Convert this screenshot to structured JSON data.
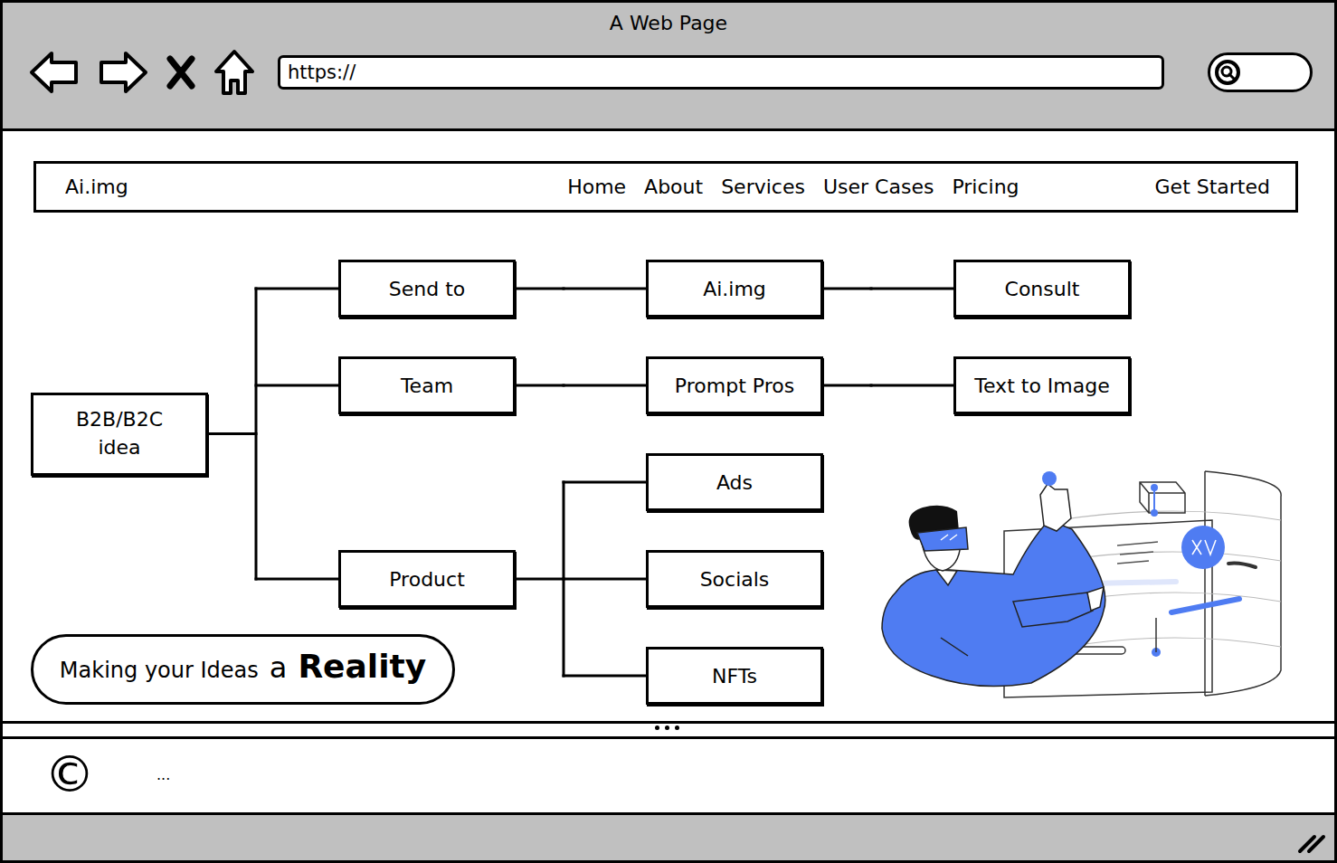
{
  "window": {
    "title": "A Web Page"
  },
  "address_bar": {
    "value": "https://"
  },
  "navbar": {
    "brand": "Ai.img",
    "links": [
      "Home",
      "About",
      "Services",
      "User Cases",
      "Pricing"
    ],
    "cta": "Get Started"
  },
  "diagram": {
    "root": {
      "label": "B2B/B2C idea",
      "children": [
        {
          "label": "Send to",
          "children": [
            {
              "label": "Ai.img",
              "children": [
                {
                  "label": "Consult",
                  "children": []
                }
              ]
            }
          ]
        },
        {
          "label": "Team",
          "children": [
            {
              "label": "Prompt Pros",
              "children": [
                {
                  "label": "Text to Image",
                  "children": []
                }
              ]
            }
          ]
        },
        {
          "label": "Product",
          "children": [
            {
              "label": "Ads",
              "children": []
            },
            {
              "label": "Socials",
              "children": []
            },
            {
              "label": "NFTs",
              "children": []
            }
          ]
        }
      ]
    }
  },
  "tagline": {
    "parts": [
      {
        "text": "Making your Ideas",
        "kind": "small"
      },
      {
        "text": "a",
        "kind": "medium"
      },
      {
        "text": "Reality",
        "kind": "large"
      }
    ]
  },
  "footer": {
    "copyright": "©",
    "text": "..."
  }
}
